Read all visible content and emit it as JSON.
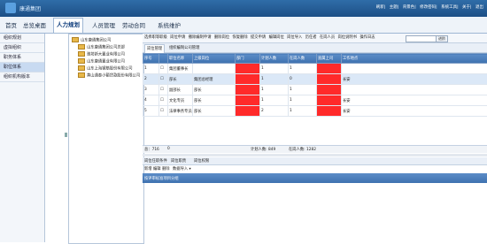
{
  "header": {
    "logo_text": "康通集团",
    "links": [
      "刷新",
      "主题",
      "背景色",
      "修改密码",
      "系统工具",
      "关于",
      "退出"
    ]
  },
  "nav": {
    "tabs": [
      "首页",
      "总览桌面",
      "人力规划",
      "人员管理",
      "劳动合同",
      "系统维护"
    ],
    "active_index": 2
  },
  "sidebar": {
    "items": [
      "组织规划",
      "虚拟组织",
      "职务体系",
      "职位体系",
      "组织机构版本"
    ],
    "active_index": 3
  },
  "tree": {
    "root": "山东康通集团公司",
    "children": [
      "山东康通集团公司总部",
      "潍坊新大置业有限公司",
      "山东康通置业有限公司",
      "山东上海钢筋股份有限公司",
      "黄山通泰小额贷款股份有限公司"
    ]
  },
  "toolbar": {
    "buttons": [
      "选择职等职级",
      "岗位申请",
      "撤除编制申请",
      "删除岗位",
      "恢复删除",
      "提交申请",
      "编辑岗位",
      "岗位导入",
      "历任者",
      "在岗人员",
      "岗位说明书",
      "操作日志"
    ],
    "search_placeholder": "",
    "search_button": "进阶"
  },
  "subtabs": {
    "items": [
      "岗位管理",
      "组织编制公司管理"
    ],
    "active_index": 0
  },
  "grid": {
    "headers": [
      "序号",
      "",
      "职位名称",
      "上级岗位",
      "部门",
      "计划人数",
      "在岗人数",
      "直属上司",
      "工作地点"
    ],
    "rows": [
      [
        "1",
        "集团董事长",
        "",
        "",
        "1",
        "1",
        "",
        ""
      ],
      [
        "2",
        "部长",
        "集团总经理",
        "",
        "1",
        "0",
        "",
        "长安"
      ],
      [
        "3",
        "副部长",
        "部长",
        "",
        "1",
        "1",
        "",
        ""
      ],
      [
        "4",
        "文化专员",
        "部长",
        "",
        "1",
        "1",
        "",
        "长安"
      ],
      [
        "5",
        "法律事务专员",
        "部长",
        "",
        "2",
        "1",
        "",
        "长安"
      ]
    ],
    "selected_row": 1
  },
  "footer": {
    "total_label": "总：716",
    "total_value": "0",
    "plan_label": "计划人数: 849",
    "onjob_label": "在岗人数: 1282"
  },
  "bottom": {
    "tabs": [
      "岗位任职条件",
      "岗位职责",
      "岗位权限"
    ],
    "toolbar": [
      "新增",
      "编辑",
      "删除",
      "数据导入 ▾"
    ],
    "header_label": "按评审标准项目分组"
  }
}
